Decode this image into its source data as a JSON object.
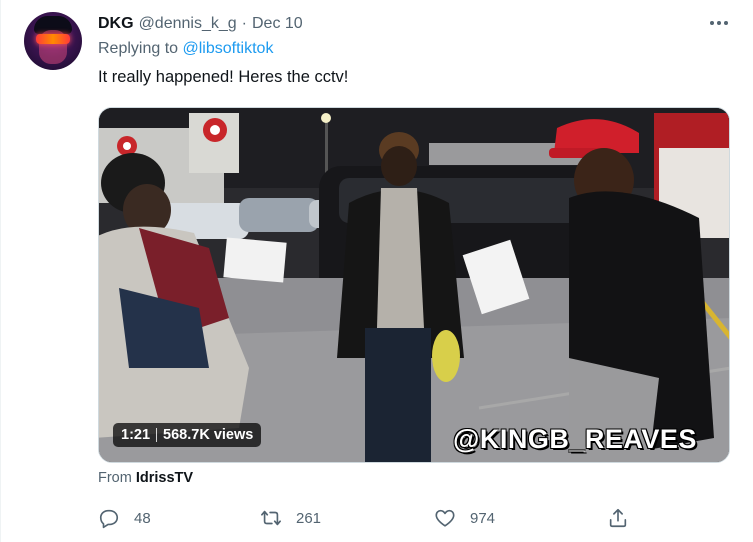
{
  "tweet": {
    "author": {
      "display_name": "DKG",
      "handle": "@dennis_k_g",
      "separator": "·",
      "date": "Dec 10"
    },
    "reply": {
      "prefix": "Replying to",
      "mention": "@libsoftiktok"
    },
    "text": "It really happened! Heres the cctv!",
    "video": {
      "duration": "1:21",
      "views": "568.7K views",
      "watermark": "@KINGB_REAVES"
    },
    "source": {
      "prefix": "From",
      "name": "IdrissTV"
    },
    "actions": {
      "replies": "48",
      "retweets": "261",
      "likes": "974"
    },
    "icons": {
      "more": "more-horizontal-icon",
      "reply": "reply-icon",
      "retweet": "retweet-icon",
      "like": "heart-icon",
      "share": "share-icon"
    },
    "colors": {
      "link": "#1d9bf0",
      "secondary_text": "#536471",
      "primary_text": "#0f1419"
    }
  }
}
